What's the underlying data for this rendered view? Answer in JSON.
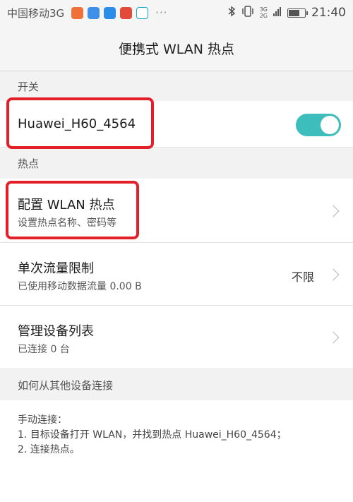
{
  "status_bar": {
    "carrier": "中国移动3G",
    "time": "21:40",
    "signal_top": "3G",
    "signal_bottom": "2G",
    "battery_level_percent": 70,
    "app_icons": [
      {
        "name": "app-icon-orange",
        "color": "#f0703a"
      },
      {
        "name": "app-icon-blue-ring",
        "color": "#3d8fe8"
      },
      {
        "name": "message-icon",
        "color": "#2b8de8"
      },
      {
        "name": "app-icon-red",
        "color": "#e24a3a"
      },
      {
        "name": "china-mobile-icon",
        "color": "#1aa8c9"
      }
    ],
    "more": "···"
  },
  "title": "便携式 WLAN 热点",
  "switch_section": {
    "header": "开关",
    "hotspot_name": "Huawei_H60_4564",
    "enabled": true,
    "toggle_color": "#3ebdbd"
  },
  "hotspot_section": {
    "header": "热点",
    "items": [
      {
        "title": "配置 WLAN 热点",
        "subtitle": "设置热点名称、密码等",
        "value": ""
      },
      {
        "title": "单次流量限制",
        "subtitle": "已使用移动数据流量 0.00 B",
        "value": "不限"
      },
      {
        "title": "管理设备列表",
        "subtitle": "已连接 0 台",
        "value": ""
      }
    ]
  },
  "connect_section": {
    "header": "如何从其他设备连接",
    "lines": [
      "手动连接：",
      "1. 目标设备打开 WLAN，并找到热点 Huawei_H60_4564；",
      "2. 连接热点。"
    ]
  },
  "highlight_color": "#e3202a"
}
